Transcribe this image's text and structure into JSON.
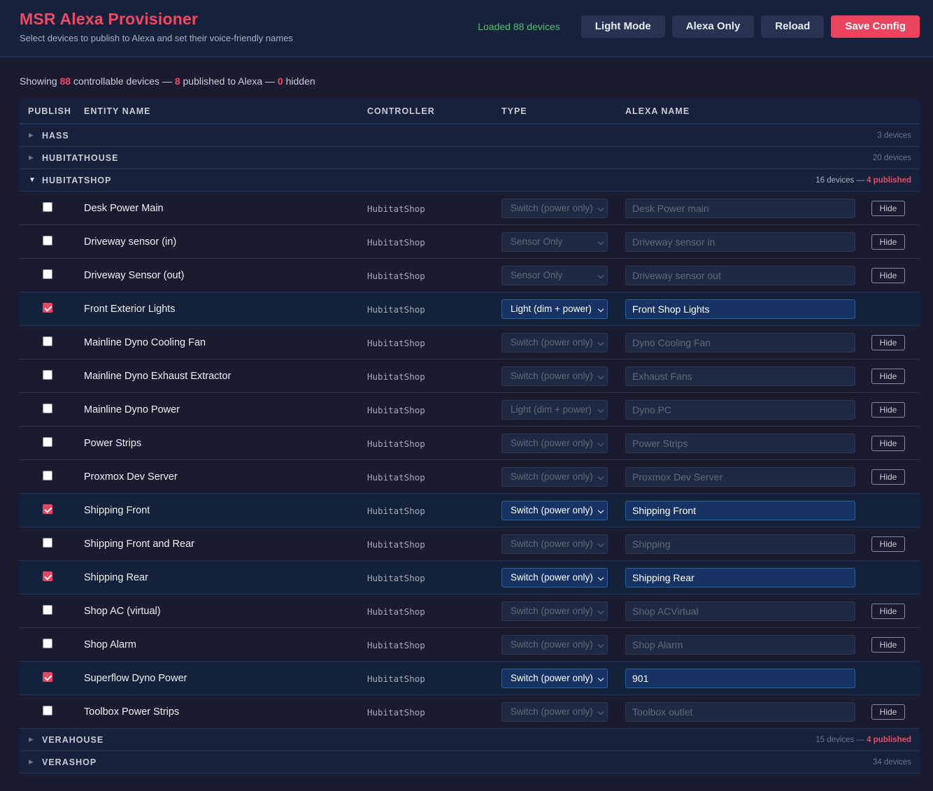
{
  "header": {
    "title": "MSR Alexa Provisioner",
    "subtitle": "Select devices to publish to Alexa and set their voice-friendly names",
    "status": "Loaded 88 devices",
    "buttons": {
      "light_mode": "Light Mode",
      "alexa_only": "Alexa Only",
      "reload": "Reload",
      "save": "Save Config"
    }
  },
  "summary": {
    "prefix": "Showing ",
    "total": "88",
    "mid1": " controllable devices — ",
    "published": "8",
    "mid2": " published to Alexa — ",
    "hidden": "0",
    "suffix": " hidden"
  },
  "columns": {
    "publish": "PUBLISH",
    "entity": "ENTITY NAME",
    "controller": "CONTROLLER",
    "type": "TYPE",
    "alexa": "ALEXA NAME"
  },
  "hide_label": "Hide",
  "groups": {
    "hass": {
      "name": "HASS",
      "count": "3 devices",
      "expanded": false
    },
    "hubitathouse": {
      "name": "HUBITATHOUSE",
      "count": "20 devices",
      "expanded": false
    },
    "hubitatshop": {
      "name": "HUBITATSHOP",
      "count": "16 devices — ",
      "published": "4 published",
      "expanded": true
    },
    "verahouse": {
      "name": "VERAHOUSE",
      "count": "15 devices — ",
      "published": "4 published",
      "expanded": false
    },
    "verashop": {
      "name": "VERASHOP",
      "count": "34 devices",
      "expanded": false
    }
  },
  "rows": [
    {
      "name": "Desk Power Main",
      "controller": "HubitatShop",
      "type": "Switch (power only)",
      "alexa": "Desk Power main",
      "published": false
    },
    {
      "name": "Driveway sensor (in)",
      "controller": "HubitatShop",
      "type": "Sensor Only",
      "alexa": "Driveway sensor in",
      "published": false
    },
    {
      "name": "Driveway Sensor (out)",
      "controller": "HubitatShop",
      "type": "Sensor Only",
      "alexa": "Driveway sensor out",
      "published": false
    },
    {
      "name": "Front Exterior Lights",
      "controller": "HubitatShop",
      "type": "Light (dim + power)",
      "alexa": "Front Shop Lights",
      "published": true
    },
    {
      "name": "Mainline Dyno Cooling Fan",
      "controller": "HubitatShop",
      "type": "Switch (power only)",
      "alexa": "Dyno Cooling Fan",
      "published": false
    },
    {
      "name": "Mainline Dyno Exhaust Extractor",
      "controller": "HubitatShop",
      "type": "Switch (power only)",
      "alexa": "Exhaust Fans",
      "published": false
    },
    {
      "name": "Mainline Dyno Power",
      "controller": "HubitatShop",
      "type": "Light (dim + power)",
      "alexa": "Dyno PC",
      "published": false
    },
    {
      "name": "Power Strips",
      "controller": "HubitatShop",
      "type": "Switch (power only)",
      "alexa": "Power Strips",
      "published": false
    },
    {
      "name": "Proxmox Dev Server",
      "controller": "HubitatShop",
      "type": "Switch (power only)",
      "alexa": "Proxmox Dev Server",
      "published": false
    },
    {
      "name": "Shipping Front",
      "controller": "HubitatShop",
      "type": "Switch (power only)",
      "alexa": "Shipping Front",
      "published": true
    },
    {
      "name": "Shipping Front and Rear",
      "controller": "HubitatShop",
      "type": "Switch (power only)",
      "alexa": "Shipping",
      "published": false
    },
    {
      "name": "Shipping Rear",
      "controller": "HubitatShop",
      "type": "Switch (power only)",
      "alexa": "Shipping Rear",
      "published": true
    },
    {
      "name": "Shop AC (virtual)",
      "controller": "HubitatShop",
      "type": "Switch (power only)",
      "alexa": "Shop ACVirtual",
      "published": false
    },
    {
      "name": "Shop Alarm",
      "controller": "HubitatShop",
      "type": "Switch (power only)",
      "alexa": "Shop Alarm",
      "published": false
    },
    {
      "name": "Superflow Dyno Power",
      "controller": "HubitatShop",
      "type": "Switch (power only)",
      "alexa": "901",
      "published": true
    },
    {
      "name": "Toolbox Power Strips",
      "controller": "HubitatShop",
      "type": "Switch (power only)",
      "alexa": "Toolbox outlet",
      "published": false
    }
  ]
}
